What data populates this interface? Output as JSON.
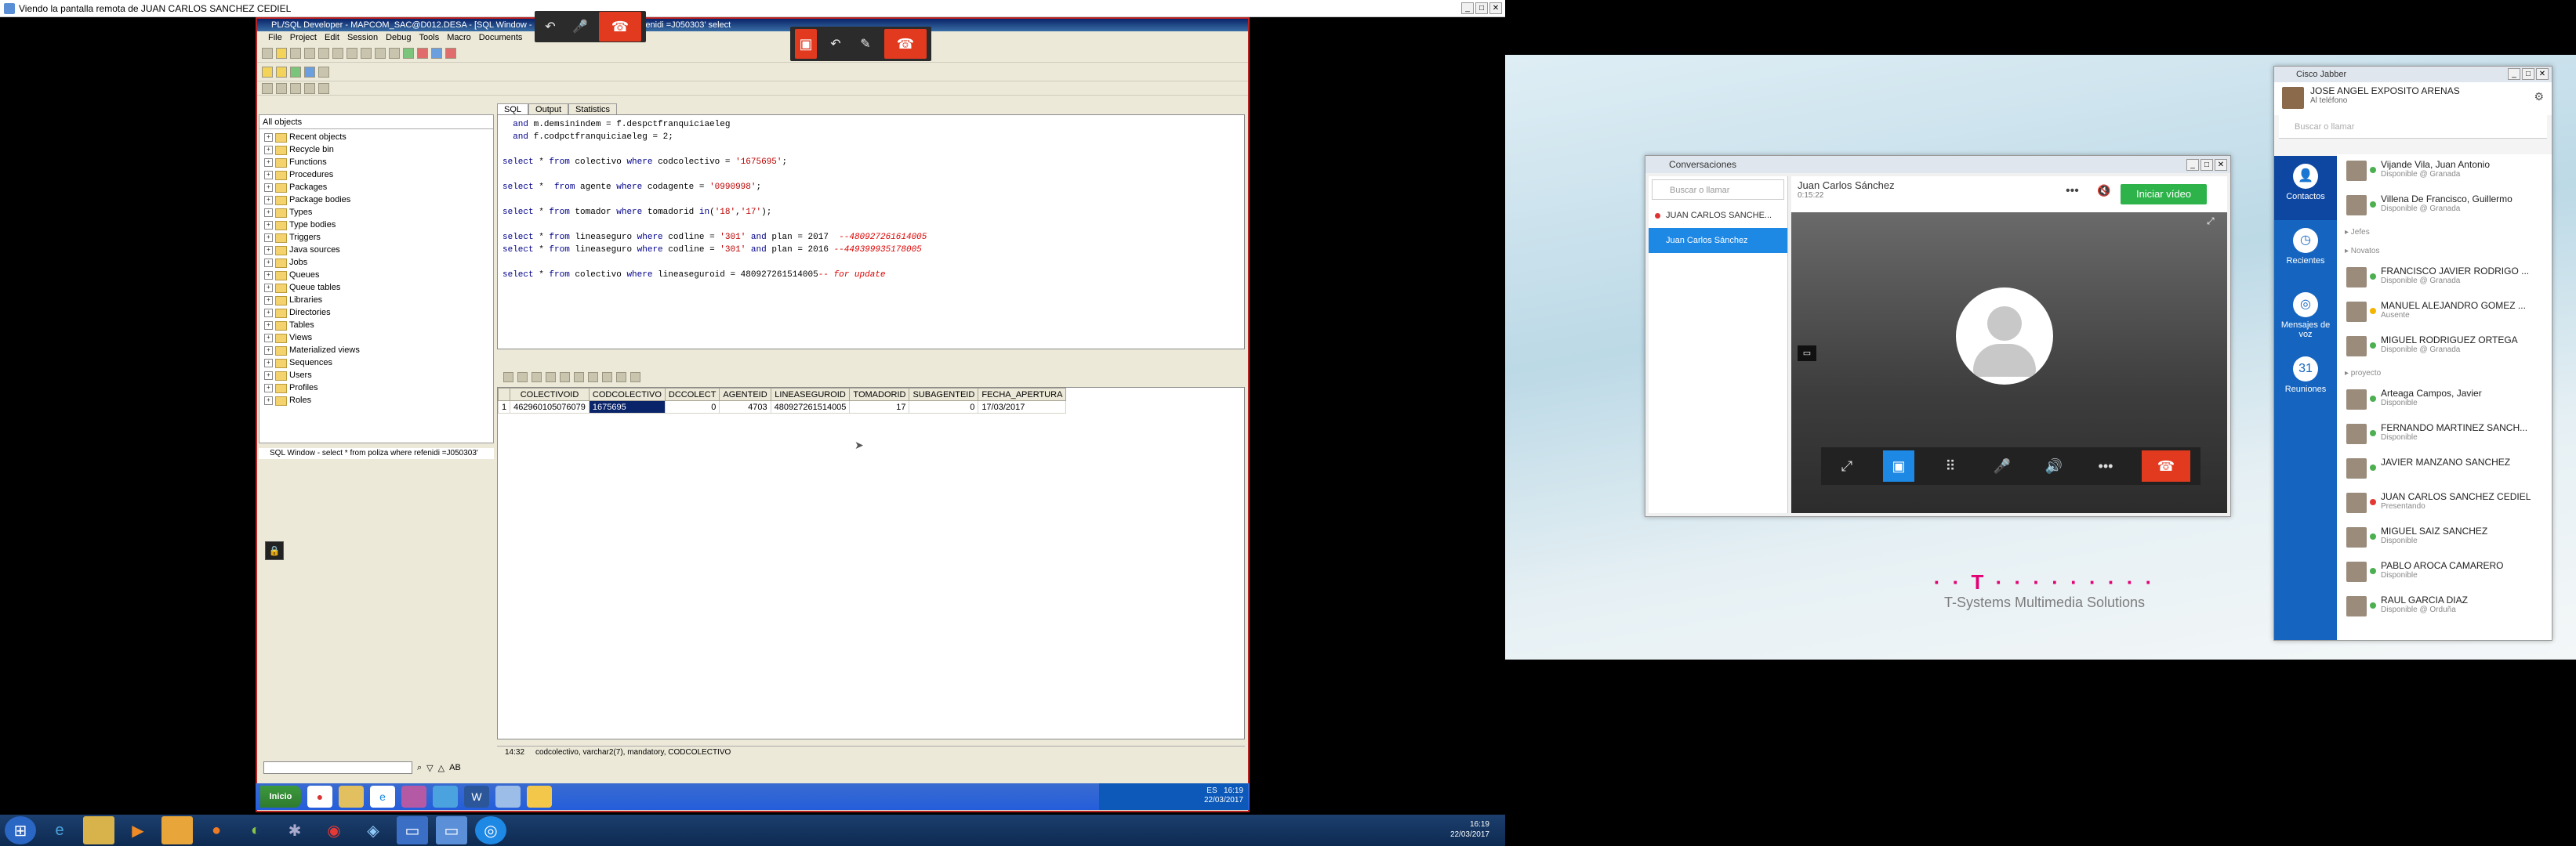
{
  "viewer": {
    "title": "Viendo la pantalla remota de JUAN CARLOS SANCHEZ CEDIEL"
  },
  "plsql": {
    "title": "PL/SQL Developer - MAPCOM_SAC@D012.DESA - [SQL Window - select * from poliza where refenidi =J050303' select",
    "menu": [
      "File",
      "Project",
      "Edit",
      "Session",
      "Debug",
      "Tools",
      "Macro",
      "Documents"
    ],
    "obj_filter": "All objects",
    "objects": [
      "Recent objects",
      "Recycle bin",
      "Functions",
      "Procedures",
      "Packages",
      "Package bodies",
      "Types",
      "Type bodies",
      "Triggers",
      "Java sources",
      "Jobs",
      "Queues",
      "Queue tables",
      "Libraries",
      "Directories",
      "Tables",
      "Views",
      "Materialized views",
      "Sequences",
      "Users",
      "Profiles",
      "Roles"
    ],
    "window_list": "SQL Window - select * from poliza where refenidi =J050303'",
    "tabs": [
      "SQL",
      "Output",
      "Statistics"
    ],
    "code": [
      "  and m.demsinindem = f.despctfranquiciaeleg",
      "  and f.codpctfranquiciaeleg = 2;",
      "",
      "select * from colectivo where codcolectivo = '1675695';",
      "",
      "select *  from agente where codagente = '0990998';",
      "",
      "select * from tomador where tomadorid in('18','17');",
      "",
      "select * from lineaseguro where codline = '301' and plan = 2017  --480927261614005",
      "select * from lineaseguro where codline = '301' and plan = 2016 --449399935178005",
      "",
      "select * from colectivo where lineaseguroid = 480927261514005-- for update"
    ],
    "grid": {
      "columns": [
        "COLECTIVOID",
        "CODCOLECTIVO",
        "DCCOLECT",
        "AGENTEID",
        "LINEASEGUROID",
        "TOMADORID",
        "SUBAGENTEID",
        "FECHA_APERTURA"
      ],
      "rows": [
        [
          "1",
          "462960105076079",
          "1675695",
          "0",
          "4703",
          "480927261514005",
          "17",
          "0",
          "17/03/2017"
        ]
      ]
    },
    "status": {
      "time": "14:32",
      "info": "codcolectivo, varchar2(7), mandatory, CODCOLECTIVO"
    },
    "find_label": "AB",
    "taskbar": {
      "start": "Inicio",
      "lang": "ES",
      "time": "16:19",
      "date": "22/03/2017"
    }
  },
  "host_tray": {
    "time": "16:19",
    "date": "22/03/2017"
  },
  "conversation": {
    "title": "Conversaciones",
    "search_placeholder": "Buscar o llamar",
    "items": [
      "JUAN CARLOS SANCHE...",
      "Juan Carlos Sánchez"
    ],
    "contact": "Juan Carlos Sánchez",
    "duration": "0:15:22",
    "video_button": "Iniciar vídeo"
  },
  "tsystems": {
    "brand": "· · T · · · · · · · · ·",
    "name": "T-Systems Multimedia Solutions"
  },
  "jabber": {
    "title": "Cisco Jabber",
    "user_name": "JOSE ANGEL EXPOSITO ARENAS",
    "user_status": "Al teléfono",
    "search_placeholder": "Buscar o llamar",
    "nav": [
      {
        "label": "Contactos",
        "icon": "person-icon"
      },
      {
        "label": "Recientes",
        "icon": "clock-icon"
      },
      {
        "label": "Mensajes de voz",
        "icon": "voicemail-icon"
      },
      {
        "label": "Reuniones",
        "icon": "calendar-icon"
      }
    ],
    "groups": {
      "jefes": "Jefes",
      "novatos": "Novatos",
      "proyecto": "proyecto"
    },
    "top_contacts": [
      {
        "name": "Vijande Vila, Juan Antonio",
        "status": "Disponible @ Granada",
        "state": "ok"
      },
      {
        "name": "Villena De Francisco, Guillermo",
        "status": "Disponible @ Granada",
        "state": "ok"
      }
    ],
    "novatos": [
      {
        "name": "FRANCISCO JAVIER RODRIGO ...",
        "status": "Disponible @ Granada",
        "state": "ok"
      },
      {
        "name": "MANUEL ALEJANDRO GOMEZ ...",
        "status": "Ausente",
        "state": "away"
      },
      {
        "name": "MIGUEL RODRIGUEZ ORTEGA",
        "status": "Disponible @ Granada",
        "state": "ok"
      }
    ],
    "proyecto": [
      {
        "name": "Arteaga Campos, Javier",
        "status": "Disponible",
        "state": "ok"
      },
      {
        "name": "FERNANDO MARTINEZ SANCH...",
        "status": "Disponible",
        "state": "ok"
      },
      {
        "name": "JAVIER MANZANO SANCHEZ",
        "status": "",
        "state": "ok"
      },
      {
        "name": "JUAN CARLOS SANCHEZ CEDIEL",
        "status": "Presentando",
        "state": "busy"
      },
      {
        "name": "MIGUEL SAIZ SANCHEZ",
        "status": "Disponible",
        "state": "ok"
      },
      {
        "name": "PABLO AROCA CAMARERO",
        "status": "Disponible",
        "state": "ok"
      },
      {
        "name": "RAUL GARCIA DIAZ",
        "status": "Disponible @ Orduña",
        "state": "ok"
      }
    ]
  }
}
